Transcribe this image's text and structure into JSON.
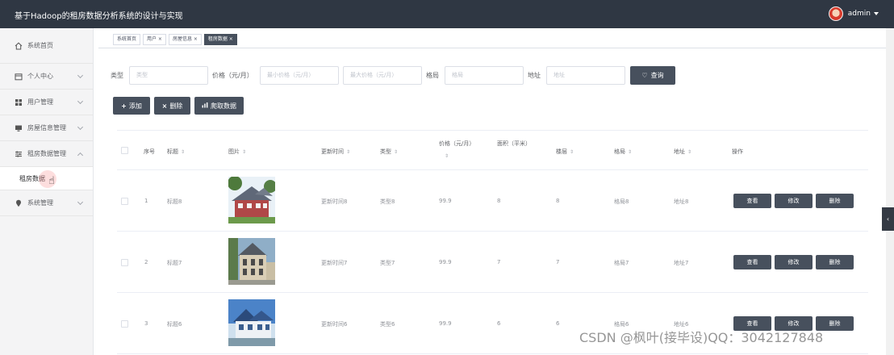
{
  "header": {
    "title": "基于Hadoop的租房数据分析系统的设计与实现",
    "user": "admin"
  },
  "sidebar": {
    "items": [
      {
        "label": "系统首页",
        "icon": "home-icon"
      },
      {
        "label": "个人中心",
        "icon": "calendar-icon"
      },
      {
        "label": "用户管理",
        "icon": "grid-icon"
      },
      {
        "label": "房屋信息管理",
        "icon": "monitor-icon"
      },
      {
        "label": "租房数据管理",
        "icon": "sliders-icon"
      },
      {
        "label": "系统管理",
        "icon": "location-pin-icon"
      }
    ],
    "submenu": "租房数据"
  },
  "tabs": [
    "系统首页",
    "用户 ×",
    "房屋信息 ×",
    "租房数据 ×"
  ],
  "search": {
    "type_label": "类型",
    "type_placeholder": "类型",
    "price_label": "价格（元/月）",
    "min_price_placeholder": "最小价格（元/月）",
    "max_price_placeholder": "最大价格（元/月）",
    "layout_label": "格局",
    "layout_placeholder": "格局",
    "address_label": "地址",
    "address_placeholder": "地址",
    "query_button": "查询"
  },
  "toolbar": {
    "add": "添加",
    "delete": "删除",
    "crawl": "爬取数据"
  },
  "table": {
    "headers": {
      "index": "序号",
      "title": "标题",
      "image": "图片",
      "update_time": "更新时间",
      "type": "类型",
      "price": "价格（元/月）",
      "area": "面积（平米）",
      "floor": "楼层",
      "layout": "格局",
      "address": "地址",
      "operation": "操作"
    },
    "rows": [
      {
        "index": "1",
        "title": "标题8",
        "update_time": "更新时间8",
        "type": "类型8",
        "price": "99.9",
        "area": "8",
        "floor": "8",
        "layout": "格局8",
        "address": "地址8"
      },
      {
        "index": "2",
        "title": "标题7",
        "update_time": "更新时间7",
        "type": "类型7",
        "price": "99.9",
        "area": "7",
        "floor": "7",
        "layout": "格局7",
        "address": "地址7"
      },
      {
        "index": "3",
        "title": "标题6",
        "update_time": "更新时间6",
        "type": "类型6",
        "price": "99.9",
        "area": "6",
        "floor": "6",
        "layout": "格局6",
        "address": "地址6"
      }
    ],
    "ops": {
      "view": "查看",
      "edit": "修改",
      "delete": "删除"
    }
  },
  "watermark": "CSDN @枫叶(接毕设)QQ：3042127848",
  "colors": {
    "header_bg": "#2f3743",
    "button_bg": "#47505d"
  }
}
